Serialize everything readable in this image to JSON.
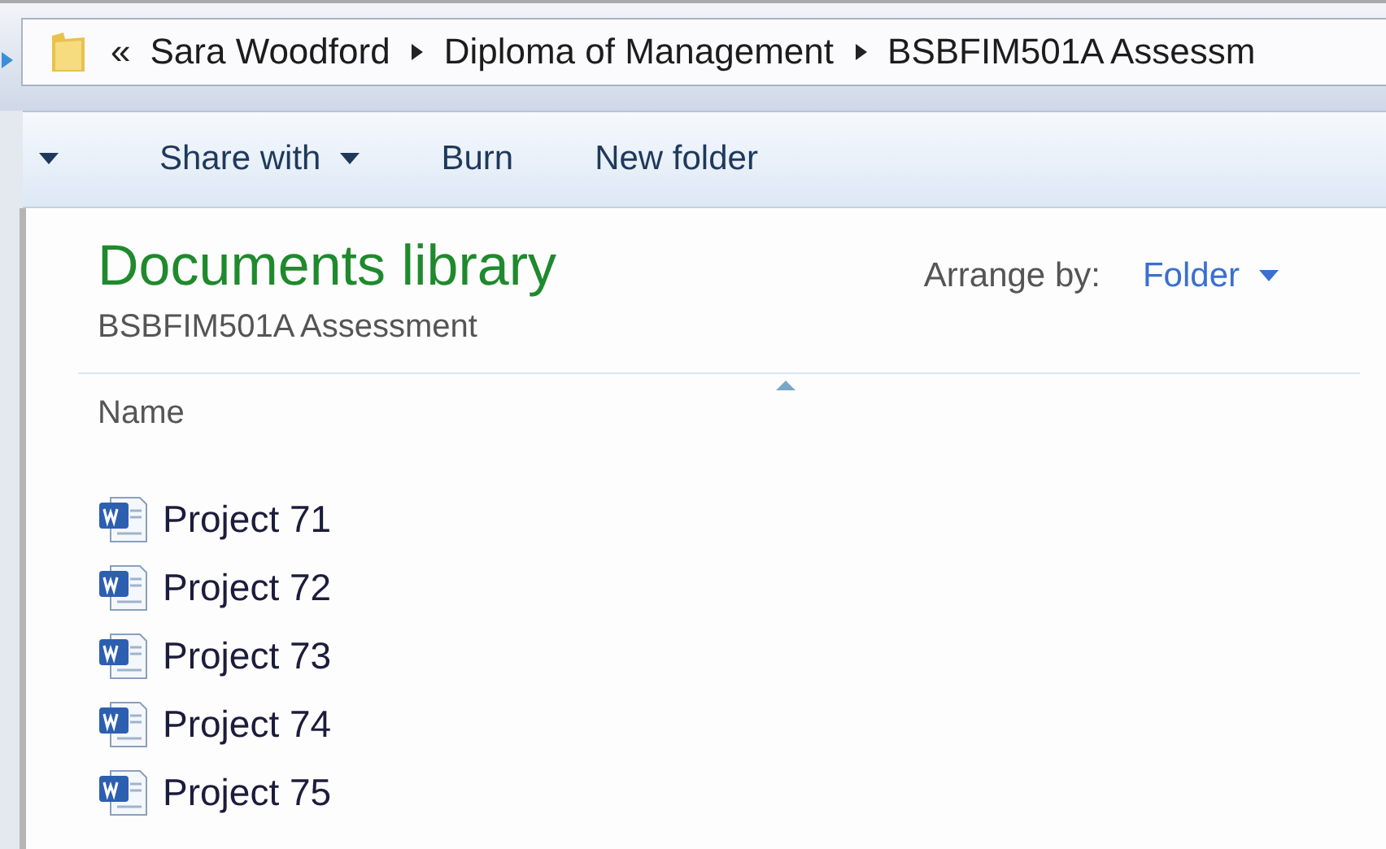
{
  "address_bar": {
    "overflow": "«",
    "crumbs": [
      "Sara Woodford",
      "Diploma of Management",
      "BSBFIM501A Assessm"
    ]
  },
  "toolbar": [
    {
      "label": "Share with",
      "dropdown": true
    },
    {
      "label": "Burn",
      "dropdown": false
    },
    {
      "label": "New folder",
      "dropdown": false
    }
  ],
  "library": {
    "title": "Documents library",
    "subtitle": "BSBFIM501A Assessment",
    "arrange_label": "Arrange by:",
    "arrange_value": "Folder"
  },
  "columns": [
    "Name"
  ],
  "files": [
    "Project 71",
    "Project 72",
    "Project 73",
    "Project 74",
    "Project 75"
  ]
}
